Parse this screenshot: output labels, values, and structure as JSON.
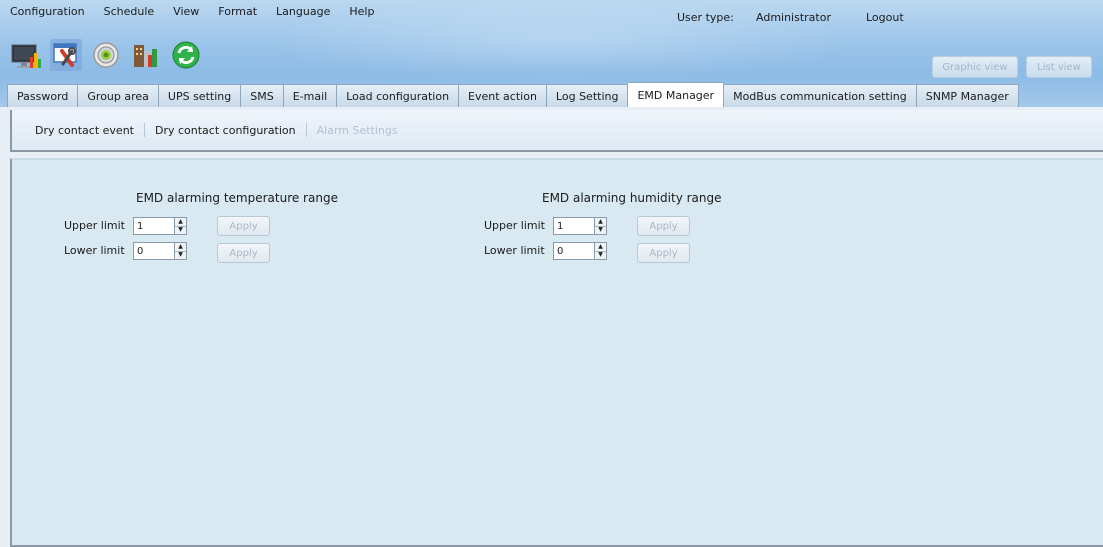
{
  "menu": [
    "Configuration",
    "Schedule",
    "View",
    "Format",
    "Language",
    "Help"
  ],
  "user": {
    "type_label": "User type:",
    "name": "Administrator",
    "logout": "Logout"
  },
  "toolbar_icons": [
    "monitor-icon",
    "tools-icon",
    "settings-icon",
    "buildings-icon",
    "refresh-icon"
  ],
  "view_buttons": {
    "graphic": "Graphic view",
    "list": "List view"
  },
  "tabs": [
    "Password",
    "Group area",
    "UPS setting",
    "SMS",
    "E-mail",
    "Load configuration",
    "Event action",
    "Log Setting",
    "EMD Manager",
    "ModBus communication setting",
    "SNMP Manager"
  ],
  "active_tab": "EMD Manager",
  "subnav": {
    "dry_contact_event": "Dry contact event",
    "dry_contact_configuration": "Dry contact configuration",
    "alarm_settings": "Alarm Settings"
  },
  "temperature": {
    "title": "EMD alarming temperature range",
    "upper_label": "Upper limit",
    "upper_value": "1",
    "lower_label": "Lower limit",
    "lower_value": "0",
    "apply": "Apply"
  },
  "humidity": {
    "title": "EMD alarming humidity range",
    "upper_label": "Upper limit",
    "upper_value": "1",
    "lower_label": "Lower limit",
    "lower_value": "0",
    "apply": "Apply"
  },
  "colors": {
    "header_blue": "#9cc5ea",
    "content_bg": "#d8e9f1",
    "disabled_text": "#a9b7c5"
  }
}
